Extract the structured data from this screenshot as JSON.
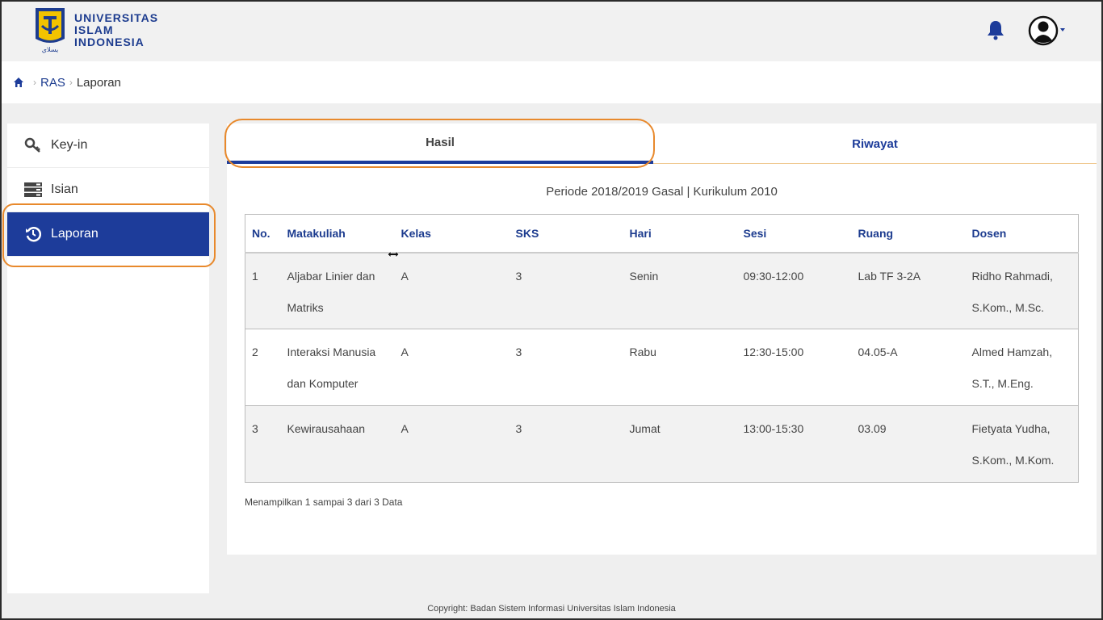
{
  "header": {
    "logo_lines": [
      "UNIVERSITAS",
      "ISLAM",
      "INDONESIA"
    ],
    "logo_script": "يسلاي",
    "notification_icon": "bell-icon",
    "user_icon": "user-avatar-icon"
  },
  "breadcrumb": {
    "items": [
      "RAS",
      "Laporan"
    ]
  },
  "sidebar": {
    "items": [
      {
        "label": "Key-in",
        "icon": "key-icon"
      },
      {
        "label": "Isian",
        "icon": "server-list-icon"
      },
      {
        "label": "Laporan",
        "icon": "history-icon",
        "active": true
      }
    ]
  },
  "tabs": [
    {
      "label": "Hasil",
      "active": true
    },
    {
      "label": "Riwayat",
      "active": false
    }
  ],
  "period_text": "Periode 2018/2019 Gasal | Kurikulum 2010",
  "table": {
    "columns": [
      "No.",
      "Matakuliah",
      "Kelas",
      "SKS",
      "Hari",
      "Sesi",
      "Ruang",
      "Dosen"
    ],
    "rows": [
      [
        "1",
        "Aljabar Linier dan Matriks",
        "A",
        "3",
        "Senin",
        "09:30-12:00",
        "Lab TF 3-2A",
        "Ridho Rahmadi, S.Kom., M.Sc."
      ],
      [
        "2",
        "Interaksi Manusia dan Komputer",
        "A",
        "3",
        "Rabu",
        "12:30-15:00",
        "04.05-A",
        "Almed Hamzah, S.T., M.Eng."
      ],
      [
        "3",
        "Kewirausahaan",
        "A",
        "3",
        "Jumat",
        "13:00-15:30",
        "03.09",
        "Fietyata Yudha, S.Kom., M.Kom."
      ]
    ]
  },
  "summary_text": "Menampilkan 1 sampai 3 dari 3 Data",
  "footer_text": "Copyright: Badan Sistem Informasi Universitas Islam Indonesia",
  "colors": {
    "primary": "#1d3c9a",
    "highlight": "#e8892c",
    "background": "#efefef"
  }
}
